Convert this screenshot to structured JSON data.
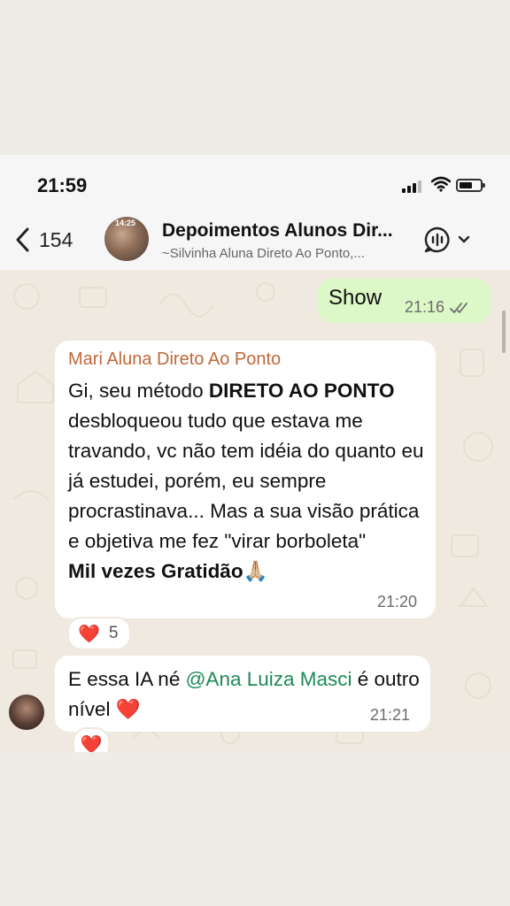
{
  "status_bar": {
    "time": "21:59"
  },
  "header": {
    "back_count": "154",
    "avatar_tag": "14:25",
    "title": "Depoimentos Alunos Dir...",
    "subtitle": "~Silvinha Aluna Direto Ao Ponto,..."
  },
  "messages": {
    "outgoing": {
      "text": "Show",
      "time": "21:16"
    },
    "incoming1": {
      "sender": "Mari Aluna Direto Ao Ponto",
      "part1": "Gi, seu método ",
      "bold1": "DIRETO AO PONTO",
      "part2": " desbloqueou tudo que estava me travando, vc não tem idéia do quanto eu já estudei, porém, eu sempre procrastinava... Mas a sua visão prática e objetiva me fez \"virar borboleta\"",
      "bold2": "Mil vezes Gratidão",
      "emoji": "🙏🏼",
      "time": "21:20",
      "reaction": {
        "emoji": "❤️",
        "count": "5"
      }
    },
    "incoming2": {
      "part1": "E essa IA né ",
      "mention": "@Ana Luiza Masci",
      "part2": " é outro nível ",
      "emoji": "❤️",
      "time": "21:21",
      "reaction": {
        "emoji": "❤️"
      }
    }
  },
  "colors": {
    "outgoing_bubble": "#dcf8c6",
    "incoming_bubble": "#ffffff",
    "sender_name": "#c0683a",
    "mention": "#1e8a5a",
    "chat_background": "#efe9df"
  },
  "icons": {
    "back": "chevron-left-icon",
    "call": "audio-call-icon",
    "dropdown": "chevron-down-icon",
    "read_receipt": "double-check-icon",
    "signal": "signal-icon",
    "wifi": "wifi-icon",
    "battery": "battery-icon"
  }
}
